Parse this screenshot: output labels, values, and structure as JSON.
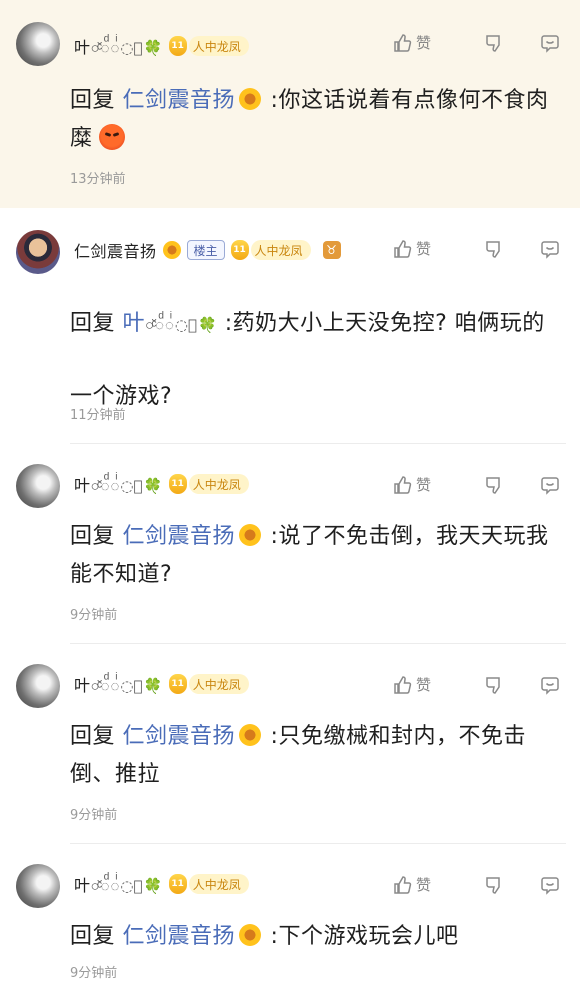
{
  "common": {
    "reply_word": "回复",
    "colon": ":",
    "like_label": "赞",
    "level_num": "11",
    "title_badge": "人中龙凤",
    "owner_badge": "楼主",
    "sign_badge": "♉",
    "user_a_main": "叶",
    "user_a_deco": "○ͫ◌̆̈◌ͩ◌ͩ◌ᷓ",
    "user_a_clover": "🍀",
    "user_b": "仁剑震音扬"
  },
  "comments": [
    {
      "mention": "仁剑震音扬",
      "text": "你这话说着有点像何不食肉糜",
      "time": "13分钟前"
    },
    {
      "mention": "叶○◌̆◌ͩ◌ᷓ",
      "text": "药奶大小上天没免控? 咱俩玩的一个游戏?",
      "time": "11分钟前"
    },
    {
      "mention": "仁剑震音扬",
      "text": "说了不免击倒，我天天玩我能不知道?",
      "time": "9分钟前"
    },
    {
      "mention": "仁剑震音扬",
      "text": "只免缴械和封内，不免击倒、推拉",
      "time": "9分钟前"
    },
    {
      "mention": "仁剑震音扬",
      "text": "下个游戏玩会儿吧",
      "time": "9分钟前"
    }
  ]
}
